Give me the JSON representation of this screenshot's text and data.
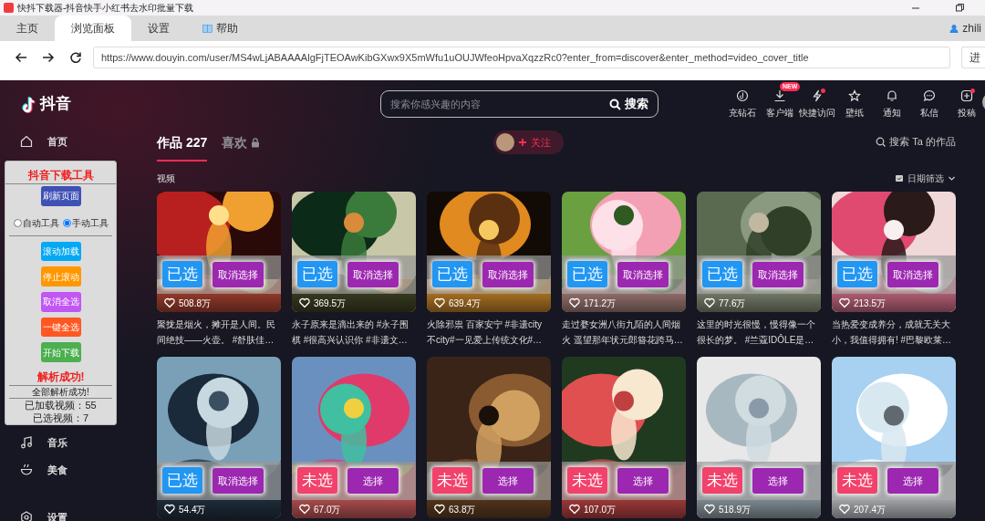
{
  "window": {
    "title": "快抖下载器-抖音快手小红书去水印批量下载"
  },
  "tabs": [
    {
      "label": "主页",
      "selected": false,
      "kind": "plain"
    },
    {
      "label": "浏览面板",
      "selected": true,
      "kind": "plain"
    },
    {
      "label": "设置",
      "selected": false,
      "kind": "plain"
    },
    {
      "label": "帮助",
      "selected": false,
      "kind": "help"
    }
  ],
  "user": {
    "name": "zhili"
  },
  "address_bar": {
    "url": "https://www.douyin.com/user/MS4wLjABAAAAlgFjTEOAwKibGXwx9X5mWfu1uOUJWfeoHpvaXqzzRc0?enter_from=discover&enter_method=video_cover_title",
    "go_button": "进"
  },
  "douyin": {
    "logo": "抖音",
    "search": {
      "placeholder": "搜索你感兴趣的内容",
      "button": "搜索"
    },
    "header_actions": [
      {
        "label": "充钻石",
        "kind": "coin"
      },
      {
        "label": "客户端",
        "kind": "download",
        "badge": "NEW"
      },
      {
        "label": "快捷访问",
        "kind": "bolt",
        "dot": true
      },
      {
        "label": "壁纸",
        "kind": "star"
      },
      {
        "label": "通知",
        "kind": "bell"
      },
      {
        "label": "私信",
        "kind": "chat"
      },
      {
        "label": "投稿",
        "kind": "plus",
        "dot": true
      }
    ],
    "sidebar": [
      {
        "label": "首页",
        "kind": "home"
      },
      {
        "label": "音乐",
        "kind": "music"
      },
      {
        "label": "美食",
        "kind": "food"
      },
      {
        "label": "设置",
        "kind": "gear"
      }
    ],
    "profile_tabs": [
      {
        "label": "作品 227",
        "selected": true,
        "locked": false
      },
      {
        "label": "喜欢",
        "selected": false,
        "locked": true
      }
    ],
    "follow_button": "关注",
    "search_works": "搜索 Ta 的作品",
    "section_title": "视频",
    "date_filter": "日期筛选",
    "videos": [
      {
        "status": "已选",
        "action": "取消选择",
        "selected": true,
        "likes": "508.8万",
        "caption": "聚拢是烟火，摊开是人间。民间绝技——火壶。 #舒肤佳…"
      },
      {
        "status": "已选",
        "action": "取消选择",
        "selected": true,
        "likes": "369.5万",
        "caption": "永子原来是滴出来的 #永子围棋 #很高兴认识你 #非遗文…"
      },
      {
        "status": "已选",
        "action": "取消选择",
        "selected": true,
        "likes": "639.4万",
        "caption": "火除邪祟 百家安宁 #非遗city不city#一见爱上传统文化#…"
      },
      {
        "status": "已选",
        "action": "取消选择",
        "selected": true,
        "likes": "171.2万",
        "caption": "走过婺女洲八街九陌的人间烟火 遥望那年状元郎簪花跨马…"
      },
      {
        "status": "已选",
        "action": "取消选择",
        "selected": true,
        "likes": "77.6万",
        "caption": "这里的时光很慢，慢得像一个很长的梦。 #兰蔻IDÔLE是…"
      },
      {
        "status": "已选",
        "action": "取消选择",
        "selected": true,
        "likes": "213.5万",
        "caption": "当热爱变成养分，成就无关大小，我值得拥有! #巴黎欧莱…"
      },
      {
        "status": "已选",
        "action": "取消选择",
        "selected": true,
        "likes": "54.4万"
      },
      {
        "status": "未选",
        "action": "选择",
        "selected": false,
        "likes": "67.0万"
      },
      {
        "status": "未选",
        "action": "选择",
        "selected": false,
        "likes": "63.8万"
      },
      {
        "status": "未选",
        "action": "选择",
        "selected": false,
        "likes": "107.0万"
      },
      {
        "status": "未选",
        "action": "选择",
        "selected": false,
        "likes": "518.9万"
      },
      {
        "status": "未选",
        "action": "选择",
        "selected": false,
        "likes": "207.4万"
      }
    ]
  },
  "tool_panel": {
    "title": "抖音下载工具",
    "refresh_button": {
      "label": "刷新页面",
      "color": "#3f51b5"
    },
    "modes": [
      {
        "label": "自动工具",
        "selected": false
      },
      {
        "label": "手动工具",
        "selected": true
      }
    ],
    "buttons": [
      {
        "label": "滚动加载",
        "color": "#03a9f4"
      },
      {
        "label": "停止滚动",
        "color": "#ff9800"
      },
      {
        "label": "取消全选",
        "color": "#c156f2"
      },
      {
        "label": "一键全选",
        "color": "#ff5722"
      },
      {
        "label": "开始下载",
        "color": "#4caf50"
      }
    ],
    "status": "解析成功!",
    "detail": "全部解析成功!",
    "stats": [
      "已加载视频：55",
      "已选视频：7"
    ]
  }
}
